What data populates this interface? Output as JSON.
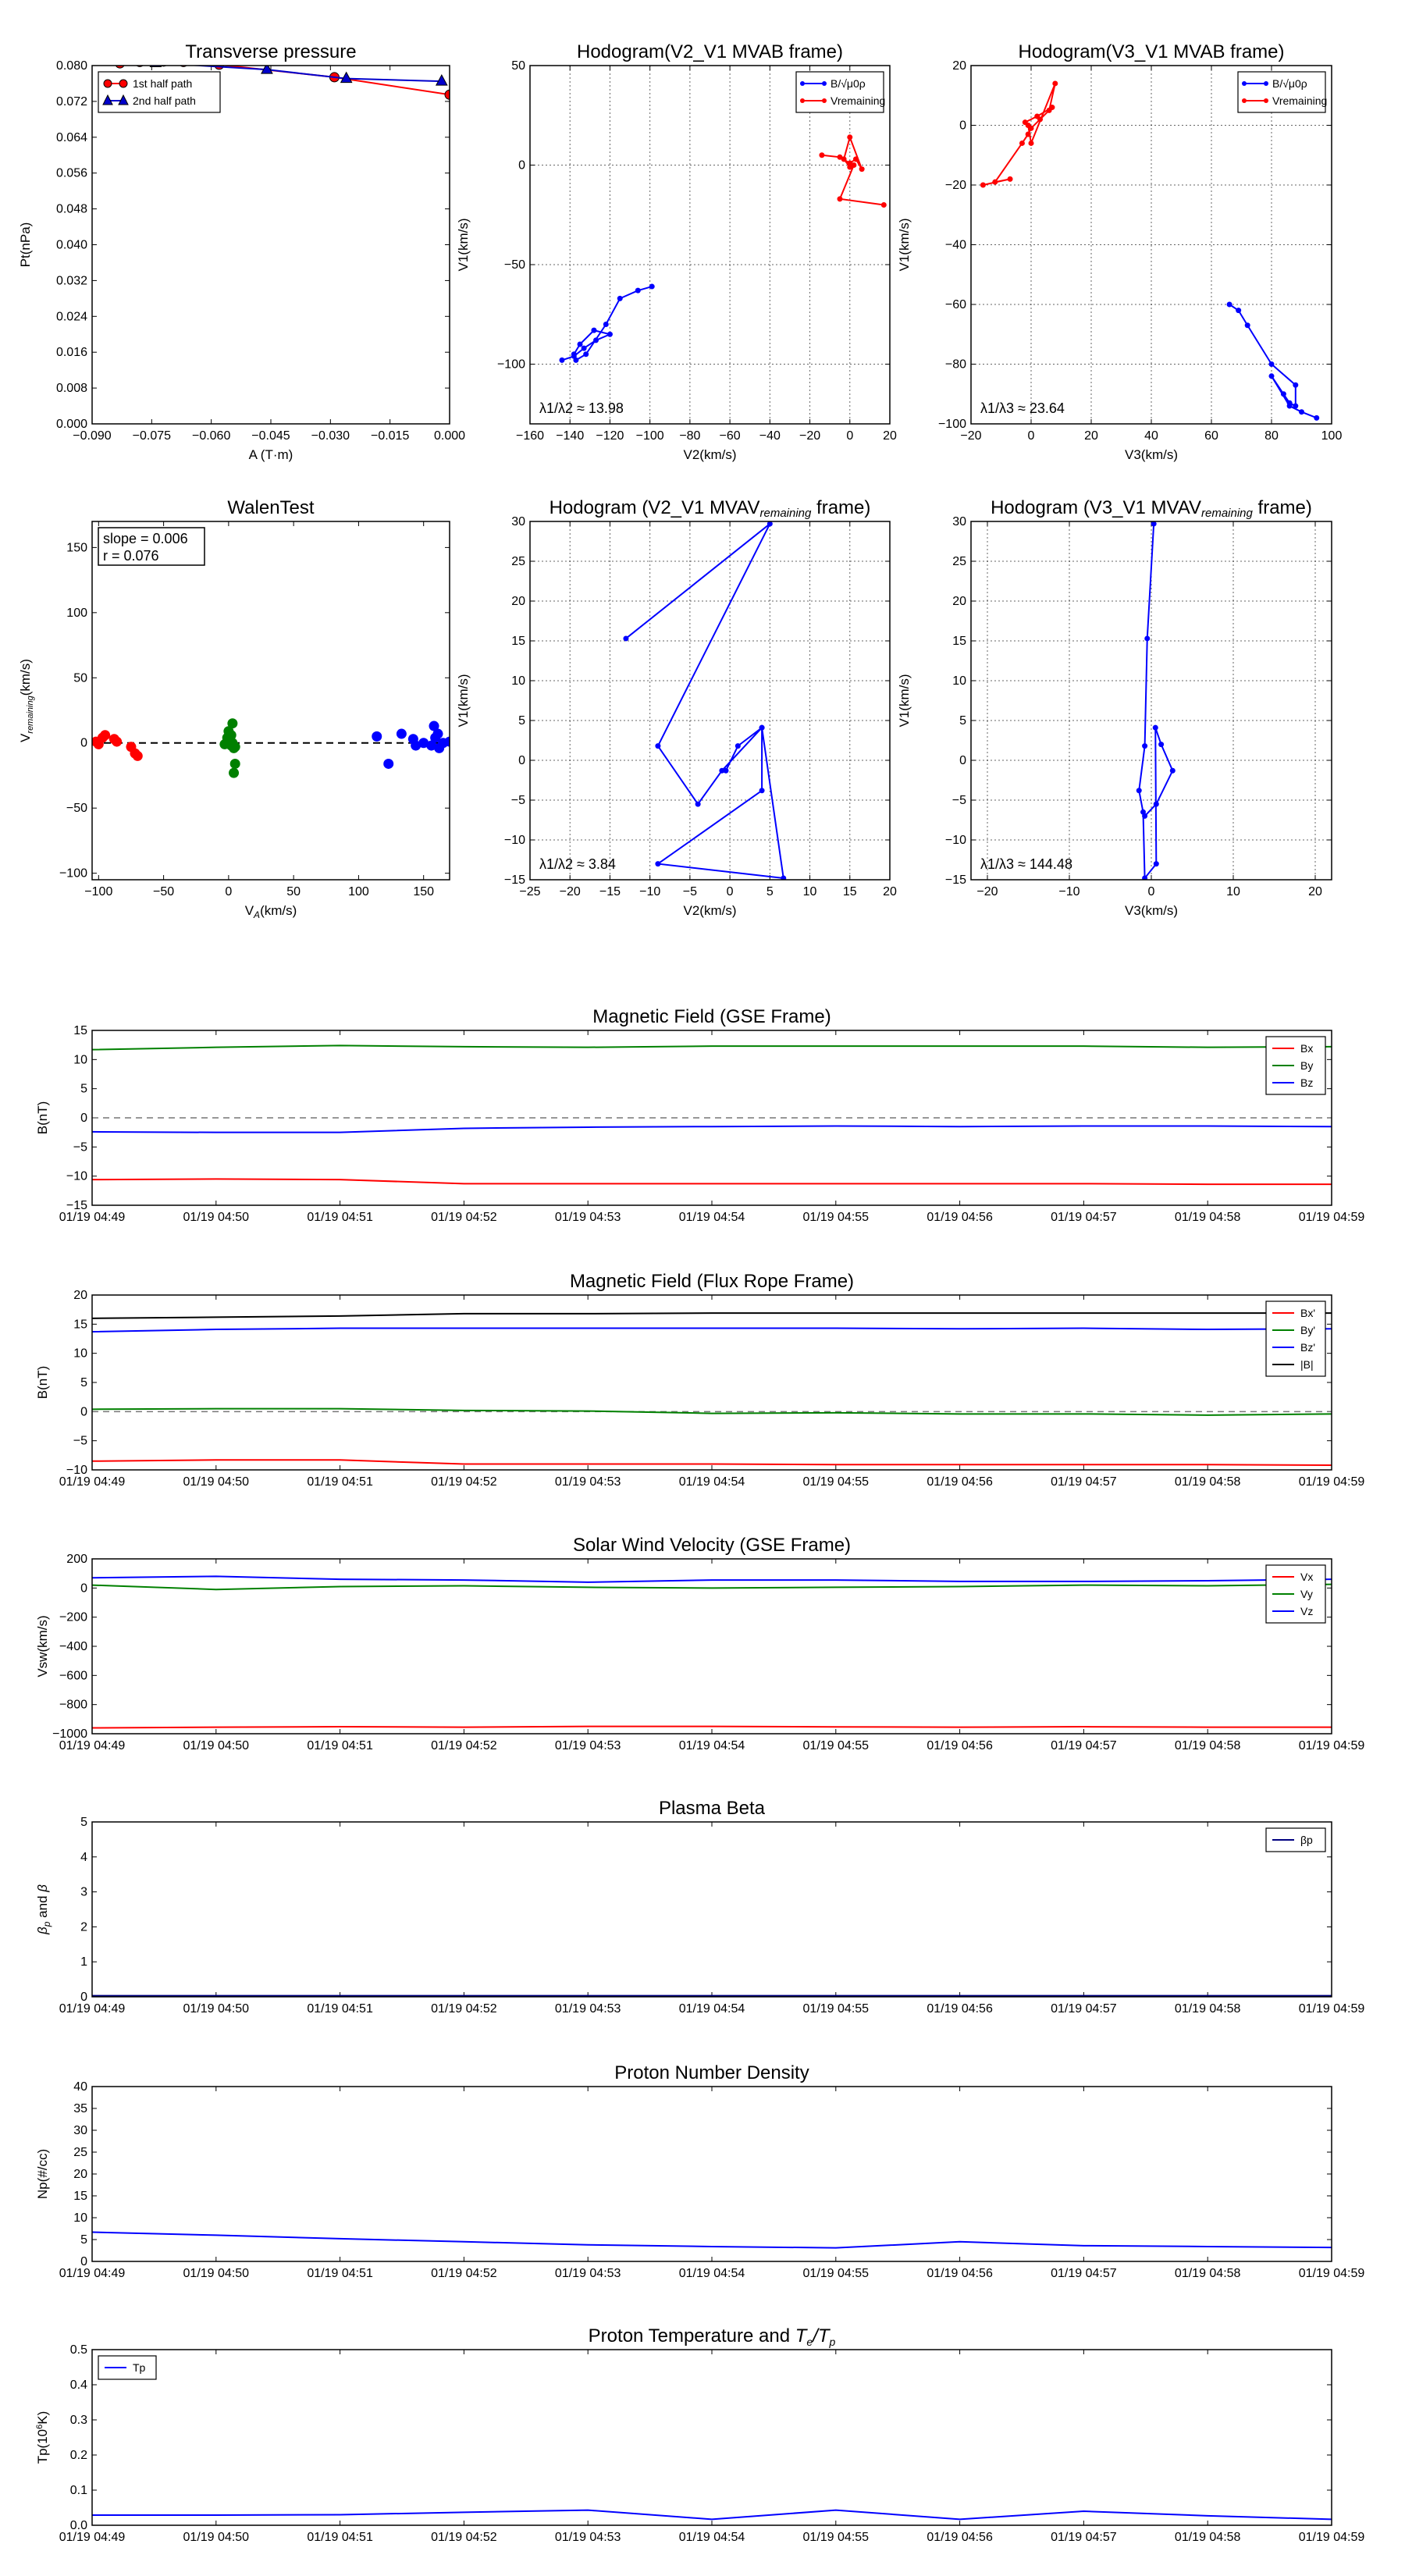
{
  "xlabels_time": [
    "01/19 04:49",
    "01/19 04:50",
    "01/19 04:51",
    "01/19 04:52",
    "01/19 04:53",
    "01/19 04:54",
    "01/19 04:55",
    "01/19 04:56",
    "01/19 04:57",
    "01/19 04:58",
    "01/19 04:59"
  ],
  "chart_data": [
    {
      "type": "line",
      "title": "Transverse pressure",
      "xlabel": "A (T·m)",
      "ylabel": "Pt(nPa)",
      "xlim": [
        -0.09,
        0.0
      ],
      "ylim": [
        0.0,
        0.08
      ],
      "xticks": [
        "−0.090",
        "−0.075",
        "−0.060",
        "−0.045",
        "−0.030",
        "−0.015",
        "0.000"
      ],
      "yticks": [
        "0.000",
        "0.008",
        "0.016",
        "0.024",
        "0.032",
        "0.040",
        "0.048",
        "0.056",
        "0.064",
        "0.072",
        "0.080"
      ],
      "grid": false,
      "legend": "top-left",
      "series": [
        {
          "name": "1st half path",
          "color": "#ff0000",
          "marker": "circle",
          "x": [
            -0.083,
            -0.078,
            -0.072,
            -0.067,
            -0.058,
            -0.029,
            0.0
          ],
          "y": [
            0.0805,
            0.0808,
            0.0809,
            0.0808,
            0.0802,
            0.0774,
            0.0735
          ]
        },
        {
          "name": "2nd half path",
          "color": "#0000cc",
          "marker": "triangle",
          "x": [
            -0.074,
            -0.046,
            -0.026,
            -0.002
          ],
          "y": [
            0.0806,
            0.0791,
            0.0771,
            0.0765
          ]
        }
      ]
    },
    {
      "type": "line",
      "title": "Hodogram(V2_V1 MVAB frame)",
      "xlabel": "V2(km/s)",
      "ylabel": "V1(km/s)",
      "xlim": [
        -160,
        20
      ],
      "ylim": [
        -130,
        50
      ],
      "xticks": [
        "−160",
        "−140",
        "−120",
        "−100",
        "−80",
        "−60",
        "−40",
        "−20",
        "0",
        "20"
      ],
      "yticks": [
        "−100",
        "−50",
        "0",
        "50"
      ],
      "ytick_values": [
        -100,
        -50,
        0,
        50
      ],
      "xtick_values": [
        -160,
        -140,
        -120,
        -100,
        -80,
        -60,
        -40,
        -20,
        0,
        20
      ],
      "grid": true,
      "legend": "top-right",
      "annotation": "λ1/λ2 ≈ 13.98",
      "series": [
        {
          "name": "B/√μ0ρ",
          "color": "#0000ff",
          "x": [
            -144,
            -138,
            -133,
            -127,
            -120,
            -128,
            -135,
            -138,
            -137,
            -132,
            -122,
            -115,
            -106,
            -99
          ],
          "y": [
            -98,
            -96,
            -92,
            -88,
            -85,
            -83,
            -90,
            -95,
            -98,
            -95,
            -80,
            -67,
            -63,
            -61
          ]
        },
        {
          "name": "Vremaining",
          "color": "#ff0000",
          "x": [
            -14,
            -5,
            0,
            3,
            6,
            0,
            -3,
            0,
            2,
            -5,
            17
          ],
          "y": [
            5,
            4,
            1,
            3,
            -2,
            14,
            3,
            -1,
            0,
            -17,
            -20
          ]
        }
      ]
    },
    {
      "type": "line",
      "title": "Hodogram(V3_V1 MVAB frame)",
      "xlabel": "V3(km/s)",
      "ylabel": "V1(km/s)",
      "xlim": [
        -20,
        100
      ],
      "ylim": [
        -100,
        20
      ],
      "xticks": [
        "−20",
        "0",
        "20",
        "40",
        "60",
        "80",
        "100"
      ],
      "yticks": [
        "−100",
        "−80",
        "−60",
        "−40",
        "−20",
        "0",
        "20"
      ],
      "grid": true,
      "legend": "top-right",
      "annotation": "λ1/λ3 ≈ 23.64",
      "series": [
        {
          "name": "B/√μ0ρ",
          "color": "#0000ff",
          "x": [
            66,
            69,
            72,
            80,
            88,
            88,
            86,
            84,
            80,
            86,
            90,
            95
          ],
          "y": [
            -60,
            -62,
            -67,
            -80,
            -87,
            -94,
            -93,
            -90,
            -84,
            -94,
            -96,
            -98
          ]
        },
        {
          "name": "Vremaining",
          "color": "#ff0000",
          "x": [
            -16,
            -7,
            -12,
            -3,
            -1,
            0,
            3,
            6,
            8,
            0,
            -1,
            -2,
            2,
            7
          ],
          "y": [
            -20,
            -18,
            -19,
            -6,
            -3,
            -1,
            2,
            5,
            14,
            -6,
            0,
            1,
            3,
            6
          ]
        }
      ]
    },
    {
      "type": "scatter",
      "title": "WalenTest",
      "xlabel": "V_A(km/s)",
      "ylabel": "V_remaining(km/s)",
      "xlim": [
        -105,
        170
      ],
      "ylim": [
        -105,
        170
      ],
      "xticks": [
        "−100",
        "−50",
        "0",
        "50",
        "100",
        "150"
      ],
      "yticks": [
        "−100",
        "−50",
        "0",
        "50",
        "100",
        "150"
      ],
      "grid": false,
      "annotation": [
        "slope = 0.006",
        "r = 0.076"
      ],
      "series": [
        {
          "name": "",
          "color": "#ff0000",
          "x": [
            -102,
            -100,
            -97,
            -95,
            -88,
            -86,
            -75,
            -72,
            -70
          ],
          "y": [
            1,
            -1,
            4,
            6,
            3,
            1,
            -3,
            -8,
            -10
          ]
        },
        {
          "name": "",
          "color": "#008000",
          "x": [
            -3,
            -1,
            0,
            1,
            2,
            2,
            3,
            3,
            4,
            5,
            4,
            5
          ],
          "y": [
            -1,
            4,
            9,
            2,
            -2,
            6,
            15,
            0,
            -4,
            -16,
            -23,
            -3
          ]
        },
        {
          "name": "",
          "color": "#0000ff",
          "x": [
            114,
            123,
            133,
            142,
            144,
            150,
            156,
            158,
            159,
            161,
            162,
            165,
            170
          ],
          "y": [
            5,
            -16,
            7,
            3,
            -2,
            0,
            -2,
            13,
            4,
            7,
            -4,
            0,
            1
          ]
        }
      ],
      "fit_line": {
        "color": "#000000",
        "style": "dashed",
        "x": [
          -105,
          170
        ],
        "y": [
          0,
          0
        ]
      }
    },
    {
      "type": "line",
      "title": "Hodogram (V2_V1 MVAV_remaining frame)",
      "xlabel": "V2(km/s)",
      "ylabel": "V1(km/s)",
      "xlim": [
        -25,
        20
      ],
      "ylim": [
        -15,
        30
      ],
      "xticks": [
        "−25",
        "−20",
        "−15",
        "−10",
        "−5",
        "0",
        "5",
        "10",
        "15",
        "20"
      ],
      "yticks": [
        "−15",
        "−10",
        "−5",
        "0",
        "5",
        "10",
        "15",
        "20",
        "25",
        "30"
      ],
      "grid": true,
      "annotation": "λ1/λ2 ≈ 3.84",
      "series": [
        {
          "name": "",
          "color": "#0000ff",
          "x": [
            -13,
            5,
            -9,
            -4,
            -1,
            4,
            4,
            -9,
            6.7,
            4,
            1,
            -0.5
          ],
          "y": [
            15.3,
            29.7,
            1.8,
            -5.5,
            -1.3,
            4.1,
            -3.8,
            -13,
            -14.8,
            4.1,
            1.8,
            -1.3
          ]
        }
      ]
    },
    {
      "type": "line",
      "title": "Hodogram (V3_V1 MVAV_remaining frame)",
      "xlabel": "V3(km/s)",
      "ylabel": "V1(km/s)",
      "xlim": [
        -22,
        22
      ],
      "ylim": [
        -15,
        30
      ],
      "xticks": [
        "−20",
        "−10",
        "0",
        "10",
        "20"
      ],
      "yticks": [
        "−15",
        "−10",
        "−5",
        "0",
        "5",
        "10",
        "15",
        "20",
        "25",
        "30"
      ],
      "grid": true,
      "annotation": "λ1/λ3 ≈ 144.48",
      "series": [
        {
          "name": "",
          "color": "#0000ff",
          "x": [
            0.3,
            -0.5,
            -0.8,
            -1.5,
            -1,
            -0.8,
            0.6,
            0.5,
            1.2,
            2.6,
            0.6,
            -0.8
          ],
          "y": [
            29.7,
            15.3,
            1.8,
            -3.8,
            -6.5,
            -14.8,
            -13,
            4.1,
            2,
            -1.3,
            -5.5,
            -7
          ]
        }
      ]
    },
    {
      "type": "line",
      "title": "Magnetic Field (GSE Frame)",
      "ylabel": "B(nT)",
      "ylim": [
        -15,
        15
      ],
      "yticks": [
        "−15",
        "−10",
        "−5",
        "0",
        "5",
        "10",
        "15"
      ],
      "grid": false,
      "legend": "top-right",
      "zero_line": true,
      "series": [
        {
          "name": "Bx",
          "color": "#ff0000",
          "y": [
            -10.6,
            -10.5,
            -10.6,
            -11.3,
            -11.3,
            -11.3,
            -11.3,
            -11.3,
            -11.3,
            -11.4,
            -11.4
          ]
        },
        {
          "name": "By",
          "color": "#008000",
          "y": [
            11.7,
            12.1,
            12.4,
            12.2,
            12.1,
            12.3,
            12.3,
            12.3,
            12.3,
            12.1,
            12.2
          ]
        },
        {
          "name": "Bz",
          "color": "#0000ff",
          "y": [
            -2.4,
            -2.5,
            -2.5,
            -1.8,
            -1.6,
            -1.5,
            -1.4,
            -1.5,
            -1.4,
            -1.4,
            -1.5
          ]
        }
      ]
    },
    {
      "type": "line",
      "title": "Magnetic Field (Flux Rope Frame)",
      "ylabel": "B(nT)",
      "ylim": [
        -10,
        20
      ],
      "yticks": [
        "−10",
        "−5",
        "0",
        "5",
        "10",
        "15",
        "20"
      ],
      "grid": false,
      "legend": "top-right",
      "zero_line": true,
      "series": [
        {
          "name": "Bx'",
          "color": "#ff0000",
          "y": [
            -8.5,
            -8.3,
            -8.3,
            -9.0,
            -9.0,
            -9.0,
            -9.1,
            -9.1,
            -9.1,
            -9.1,
            -9.2
          ]
        },
        {
          "name": "By'",
          "color": "#008000",
          "y": [
            0.4,
            0.5,
            0.5,
            0.2,
            0.1,
            -0.3,
            -0.2,
            -0.4,
            -0.4,
            -0.6,
            -0.4
          ]
        },
        {
          "name": "Bz'",
          "color": "#0000ff",
          "y": [
            13.7,
            14.1,
            14.3,
            14.3,
            14.3,
            14.3,
            14.3,
            14.2,
            14.3,
            14.1,
            14.2
          ]
        },
        {
          "name": "|B|",
          "color": "#000000",
          "y": [
            16.0,
            16.2,
            16.4,
            16.8,
            16.8,
            16.9,
            16.9,
            16.9,
            16.9,
            16.9,
            16.9
          ]
        }
      ]
    },
    {
      "type": "line",
      "title": "Solar Wind Velocity (GSE Frame)",
      "ylabel": "Vsw(km/s)",
      "ylim": [
        -1000,
        200
      ],
      "yticks": [
        "−1000",
        "−800",
        "−600",
        "−400",
        "−200",
        "0",
        "200"
      ],
      "grid": false,
      "legend": "top-right",
      "series": [
        {
          "name": "Vx",
          "color": "#ff0000",
          "y": [
            -960,
            -955,
            -952,
            -955,
            -950,
            -950,
            -953,
            -955,
            -952,
            -955,
            -955
          ]
        },
        {
          "name": "Vy",
          "color": "#008000",
          "y": [
            20,
            -10,
            10,
            15,
            5,
            0,
            5,
            10,
            20,
            15,
            25
          ]
        },
        {
          "name": "Vz",
          "color": "#0000ff",
          "y": [
            70,
            80,
            60,
            55,
            40,
            55,
            55,
            45,
            45,
            50,
            60
          ]
        }
      ]
    },
    {
      "type": "line",
      "title": "Plasma Beta",
      "ylabel": "βp and β",
      "ylim": [
        0,
        5
      ],
      "yticks": [
        "0",
        "1",
        "2",
        "3",
        "4",
        "5"
      ],
      "grid": false,
      "legend": "top-right",
      "series": [
        {
          "name": "βp",
          "color": "#000080",
          "y": [
            0.03,
            0.03,
            0.03,
            0.03,
            0.03,
            0.03,
            0.03,
            0.03,
            0.03,
            0.03,
            0.03
          ]
        }
      ]
    },
    {
      "type": "line",
      "title": "Proton Number Density",
      "ylabel": "Np(#/cc)",
      "ylim": [
        0,
        40
      ],
      "yticks": [
        "0",
        "5",
        "10",
        "15",
        "20",
        "25",
        "30",
        "35",
        "40"
      ],
      "grid": false,
      "series": [
        {
          "name": "",
          "color": "#0000ff",
          "y": [
            6.7,
            6.0,
            5.2,
            4.5,
            3.8,
            3.4,
            3.1,
            4.5,
            3.6,
            3.4,
            3.2
          ]
        }
      ]
    },
    {
      "type": "line",
      "title": "Proton Temperature and Te/Tp",
      "ylabel": "Tp(10^6K)",
      "ylim": [
        0,
        0.5
      ],
      "yticks": [
        "0.0",
        "0.1",
        "0.2",
        "0.3",
        "0.4",
        "0.5"
      ],
      "grid": false,
      "legend": "top-left",
      "series": [
        {
          "name": "Tp",
          "color": "#0000ff",
          "y": [
            0.029,
            0.029,
            0.03,
            0.037,
            0.043,
            0.017,
            0.043,
            0.017,
            0.04,
            0.027,
            0.017
          ]
        }
      ]
    }
  ]
}
